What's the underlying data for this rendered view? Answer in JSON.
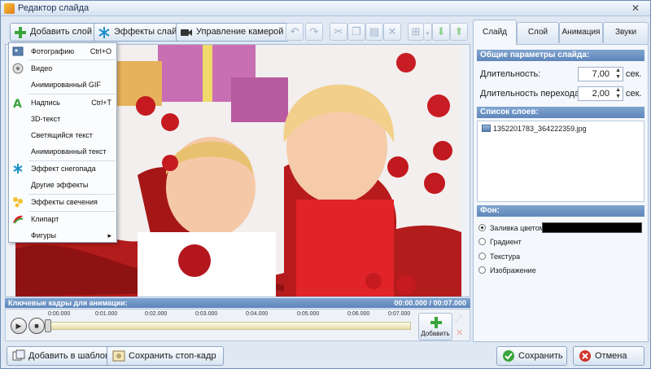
{
  "window": {
    "title": "Редактор слайда",
    "close_glyph": "✕"
  },
  "toolbar": {
    "add_layer": "Добавить слой",
    "slide_effects": "Эффекты слайда",
    "camera_control": "Управление камерой"
  },
  "menu": {
    "items": [
      {
        "label": "Фотографию",
        "shortcut": "Ctrl+O",
        "icon": "photo-icon"
      },
      {
        "label": "Видео",
        "icon": "video-icon"
      },
      {
        "label": "Анимированный GIF",
        "icon": ""
      },
      {
        "label": "Надпись",
        "shortcut": "Ctrl+T",
        "icon": "text-icon"
      },
      {
        "label": "3D-текст",
        "icon": ""
      },
      {
        "label": "Светящийся текст",
        "icon": ""
      },
      {
        "label": "Анимированный текст",
        "icon": ""
      },
      {
        "label": "Эффект снегопада",
        "icon": "snowflake-icon"
      },
      {
        "label": "Другие эффекты",
        "icon": ""
      },
      {
        "label": "Эффекты свечения",
        "icon": "glow-icon"
      },
      {
        "label": "Клипарт",
        "icon": "clipart-icon"
      },
      {
        "label": "Фигуры",
        "icon": "",
        "submenu": "▸"
      }
    ]
  },
  "keyframes": {
    "header": "Ключевые кадры для анимации:",
    "time": "00:00.000 / 00:07.000",
    "ticks": [
      "0:00.000",
      "0:01.000",
      "0:02.000",
      "0:03.000",
      "0:04.000",
      "0:05.000",
      "0:06.000",
      "0:07.000"
    ],
    "add_label": "Добавить"
  },
  "bottom": {
    "add_to_templates": "Добавить в шаблоны",
    "save_frame": "Сохранить стоп-кадр",
    "save": "Сохранить",
    "cancel": "Отмена"
  },
  "tabs": [
    "Слайд",
    "Слой",
    "Анимация",
    "Звуки"
  ],
  "panel": {
    "general_header": "Общие параметры слайда:",
    "duration_label": "Длительность:",
    "duration_value": "7,00",
    "transition_label": "Длительность перехода:",
    "transition_value": "2,00",
    "unit": "сек.",
    "layers_header": "Список слоев:",
    "layer_file": "1352201783_364222359.jpg",
    "background_header": "Фон:",
    "fill_options": [
      "Заливка цветом",
      "Градиент",
      "Текстура",
      "Изображение"
    ],
    "fill_color": "#000000"
  },
  "colors": {
    "accent": "#5f87bb",
    "add_green": "#3aa53a",
    "cancel_red": "#d0352b"
  }
}
